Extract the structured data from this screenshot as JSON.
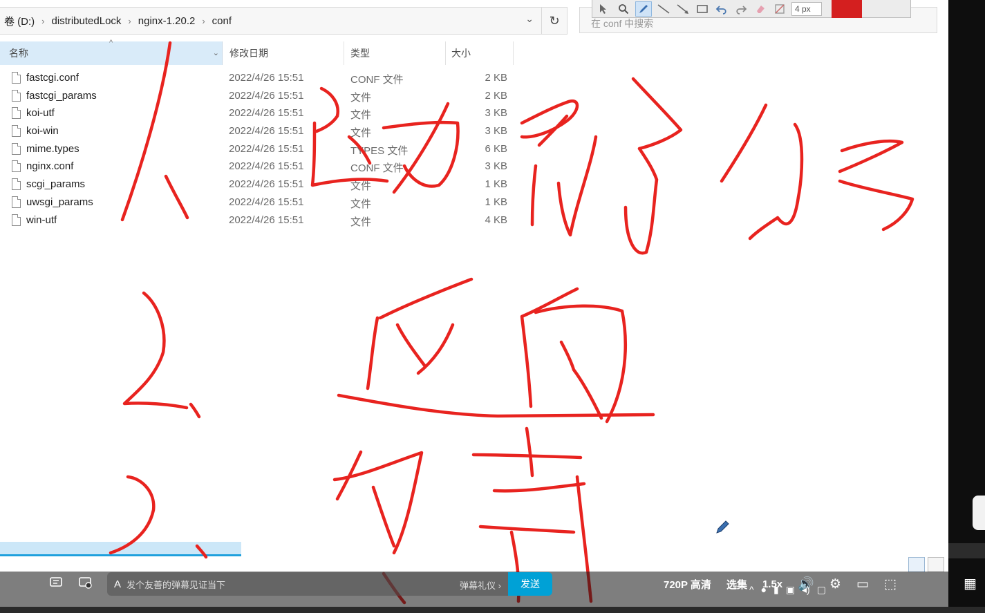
{
  "address_bar": {
    "crumbs": [
      "卷 (D:)",
      "distributedLock",
      "nginx-1.20.2",
      "conf"
    ],
    "separator": "›",
    "dropdown": "⌄",
    "refresh": "↻"
  },
  "search": {
    "placeholder": "在 conf 中搜索"
  },
  "draw_toolbar": {
    "pen_size": "4 px",
    "color": "#d41f1f"
  },
  "columns": {
    "name": "名称",
    "date": "修改日期",
    "type": "类型",
    "size": "大小"
  },
  "files": [
    {
      "name": "fastcgi.conf",
      "date": "2022/4/26 15:51",
      "type": "CONF 文件",
      "size": "2 KB"
    },
    {
      "name": "fastcgi_params",
      "date": "2022/4/26 15:51",
      "type": "文件",
      "size": "2 KB"
    },
    {
      "name": "koi-utf",
      "date": "2022/4/26 15:51",
      "type": "文件",
      "size": "3 KB"
    },
    {
      "name": "koi-win",
      "date": "2022/4/26 15:51",
      "type": "文件",
      "size": "3 KB"
    },
    {
      "name": "mime.types",
      "date": "2022/4/26 15:51",
      "type": "TYPES 文件",
      "size": "6 KB"
    },
    {
      "name": "nginx.conf",
      "date": "2022/4/26 15:51",
      "type": "CONF 文件",
      "size": "3 KB"
    },
    {
      "name": "scgi_params",
      "date": "2022/4/26 15:51",
      "type": "文件",
      "size": "1 KB"
    },
    {
      "name": "uwsgi_params",
      "date": "2022/4/26 15:51",
      "type": "文件",
      "size": "1 KB"
    },
    {
      "name": "win-utf",
      "date": "2022/4/26 15:51",
      "type": "文件",
      "size": "4 KB"
    }
  ],
  "annotation_color": "#e8231f",
  "player": {
    "danmaku_placeholder": "发个友善的弹幕见证当下",
    "danmaku_etiquette": "弹幕礼仪 ›",
    "send_label": "发送",
    "quality": "720P 高清",
    "episodes": "选集",
    "speed": "1.5x"
  }
}
